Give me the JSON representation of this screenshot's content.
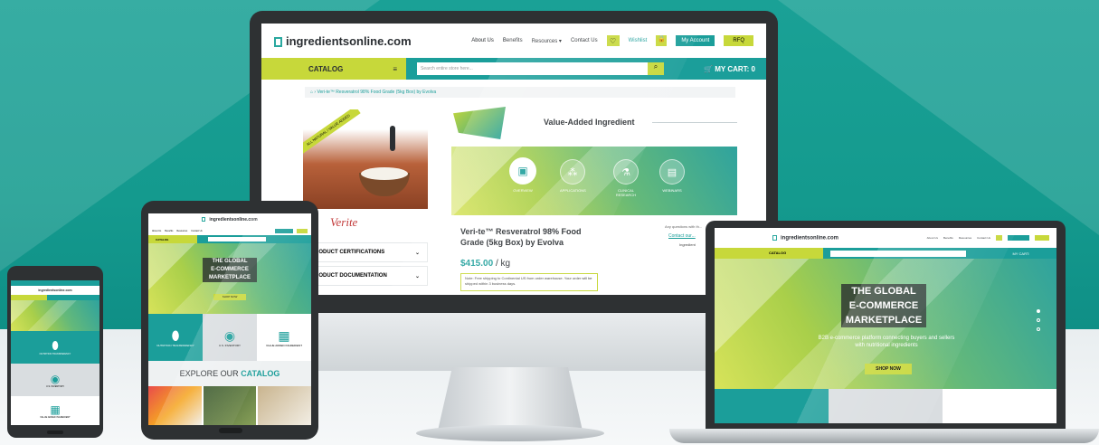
{
  "site": {
    "logo": "ingredientsonline.com",
    "nav": [
      "About Us",
      "Benefits",
      "Resources",
      "Contact Us"
    ],
    "wishlist": "Wishlist",
    "account": "My Account",
    "rfq": "RFQ",
    "catalog": "CATALOG",
    "search_placeholder": "Search entire store here...",
    "cart": "MY CART:",
    "cart_count": "0"
  },
  "monitor": {
    "breadcrumb": "Veri-te™ Resveratrol 98% Food Grade (5kg Box) by Evolva",
    "badge_text": "ALL NATURAL / VALUE ADDED",
    "value_added": "Value-Added Ingredient",
    "icons": [
      "OVERVIEW",
      "APPLICATIONS",
      "CLINICAL RESEARCH",
      "WEBINARS"
    ],
    "product_title": "Veri-te™ Resveratrol 98% Food Grade (5kg Box) by Evolva",
    "price": "$415.00",
    "unit": "/ kg",
    "shipping_note": "Note: Free shipping to Continental US from order warehouse. Your order will be shipped within 3 business days.",
    "questions": "Any questions with th...",
    "contact": "Contact our...",
    "ingredient": "Ingredient",
    "accordion": [
      "PRODUCT CERTIFICATIONS",
      "PRODUCT DOCUMENTATION"
    ],
    "brand": "Verite"
  },
  "laptop": {
    "hero_lines": [
      "THE GLOBAL",
      "E-COMMERCE",
      "MARKETPLACE"
    ],
    "hero_sub": "B2B e-commerce platform connecting buyers and sellers with nutritional ingredients",
    "shop_now": "SHOP NOW"
  },
  "tablet": {
    "hero_lines": [
      "THE GLOBAL",
      "E-COMMERCE",
      "MARKETPLACE"
    ],
    "shop_now": "SHOP NOW",
    "tiles": [
      "NUTRITION TRANSPARENCY",
      "U.S. INVENTORY",
      "VALUE ADDED INGREDIENT"
    ],
    "explore": "EXPLORE OUR",
    "explore_accent": "CATALOG"
  },
  "phone": {
    "tiles": [
      "NUTRITION TRANSPARENCY",
      "U.S. INVENTORY",
      "VALUE ADDED INGREDIENT"
    ]
  },
  "colors": {
    "teal": "#1b9e9a",
    "lime": "#c7d83a",
    "dark": "#2e3133"
  }
}
